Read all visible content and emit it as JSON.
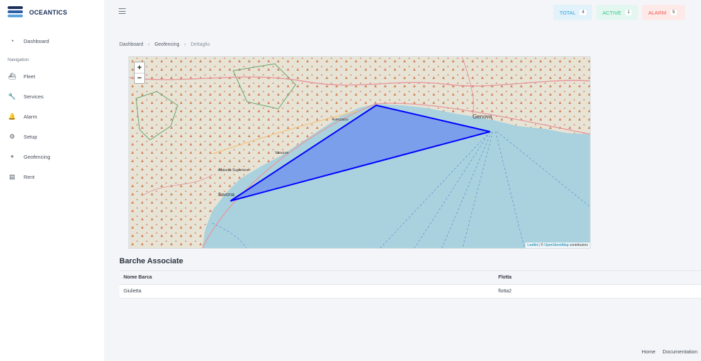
{
  "app": {
    "brand": "OCEANTICS"
  },
  "sidebar": {
    "items": [
      {
        "label": "Dashboard",
        "icon": "dashboard-icon"
      },
      {
        "label": "Fleet",
        "icon": "ship-icon"
      },
      {
        "label": "Services",
        "icon": "wrench-icon"
      },
      {
        "label": "Alarm",
        "icon": "bell-icon"
      },
      {
        "label": "Setup",
        "icon": "gear-icon"
      },
      {
        "label": "Geofencing",
        "icon": "map-pin-icon"
      },
      {
        "label": "Rent",
        "icon": "clipboard-icon"
      }
    ],
    "nav_heading": "Navigation"
  },
  "topbar": {
    "badges": [
      {
        "label": "TOTAL",
        "count": "4",
        "color": "#2ea0d8"
      },
      {
        "label": "ACTIVE",
        "count": "1",
        "color": "#34c48a"
      },
      {
        "label": "ALARM",
        "count": "5",
        "color": "#ee5a52"
      }
    ]
  },
  "breadcrumb": [
    "Dashboard",
    "Geofencing",
    "Dettaglio"
  ],
  "map": {
    "zoom_in": "+",
    "zoom_out": "−",
    "attribution": {
      "leaflet": "Leaflet",
      "sep": " | © ",
      "osm": "OpenStreetMap",
      "suffix": " contributors"
    },
    "labels": {
      "genova": "Genova",
      "savona": "Savona",
      "arenzano": "Arenzano",
      "varazze": "Varazze",
      "albisola": "Albisola Superiore"
    },
    "polygon_color": "#0000ff"
  },
  "table": {
    "title": "Barche Associate",
    "columns": [
      "Nome Barca",
      "Flotta"
    ],
    "rows": [
      [
        "Giulietta",
        "flotta2"
      ]
    ]
  },
  "footer": {
    "links": [
      "Home",
      "Documentation"
    ]
  }
}
